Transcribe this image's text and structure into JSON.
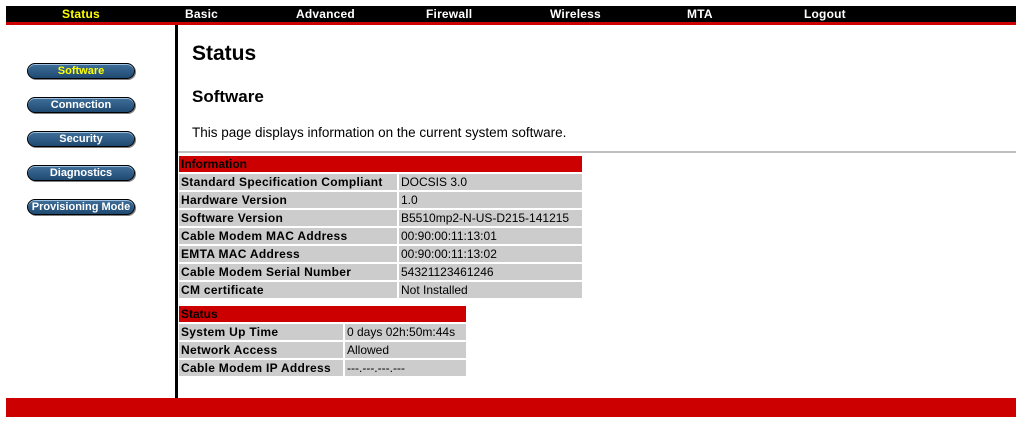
{
  "nav": {
    "status": "Status",
    "basic": "Basic",
    "advanced": "Advanced",
    "firewall": "Firewall",
    "wireless": "Wireless",
    "mta": "MTA",
    "logout": "Logout"
  },
  "sidebar": {
    "software": "Software",
    "connection": "Connection",
    "security": "Security",
    "diagnostics": "Diagnostics",
    "provisioning": "Provisioning Mode"
  },
  "main": {
    "title": "Status",
    "section": "Software",
    "description": "This page displays information on the current system software."
  },
  "information": {
    "header": "Information",
    "rows": [
      {
        "label": "Standard Specification Compliant",
        "value": "DOCSIS 3.0"
      },
      {
        "label": "Hardware Version",
        "value": "1.0"
      },
      {
        "label": "Software Version",
        "value": "B5510mp2-N-US-D215-141215"
      },
      {
        "label": "Cable Modem MAC Address",
        "value": "00:90:00:11:13:01"
      },
      {
        "label": "EMTA MAC Address",
        "value": "00:90:00:11:13:02"
      },
      {
        "label": "Cable Modem Serial Number",
        "value": "54321123461246"
      },
      {
        "label": "CM certificate",
        "value": "Not Installed"
      }
    ]
  },
  "status": {
    "header": "Status",
    "rows": [
      {
        "label": "System Up Time",
        "value": "0 days 02h:50m:44s"
      },
      {
        "label": "Network Access",
        "value": "Allowed"
      },
      {
        "label": "Cable Modem IP Address",
        "value": "---.---.---.---"
      }
    ]
  },
  "colors": {
    "accent_red": "#cc0000",
    "nav_active": "#ffff00",
    "sidebar_button": "#2a5a86",
    "cell_bg": "#cccccc"
  }
}
